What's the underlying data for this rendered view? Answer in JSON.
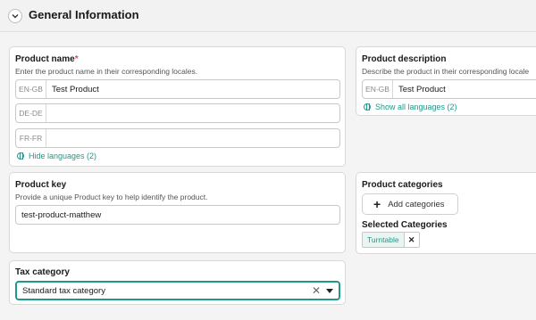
{
  "section": {
    "title": "General Information"
  },
  "product_name": {
    "label": "Product name",
    "required_mark": "*",
    "hint": "Enter the product name in their corresponding locales.",
    "locales": [
      {
        "code": "EN-GB",
        "value": "Test Product"
      },
      {
        "code": "DE-DE",
        "value": ""
      },
      {
        "code": "FR-FR",
        "value": ""
      }
    ],
    "toggle_label": "Hide languages (2)"
  },
  "product_description": {
    "label": "Product description",
    "hint": "Describe the product in their corresponding locale",
    "locales": [
      {
        "code": "EN-GB",
        "value": "Test Product"
      }
    ],
    "toggle_label": "Show all languages (2)"
  },
  "product_key": {
    "label": "Product key",
    "hint": "Provide a unique Product key to help identify the product.",
    "value": "test-product-matthew"
  },
  "product_categories": {
    "label": "Product categories",
    "add_button_label": "Add categories",
    "selected_label": "Selected Categories",
    "selected": [
      {
        "label": "Turntable",
        "remove_glyph": "✕"
      }
    ]
  },
  "tax_category": {
    "label": "Tax category",
    "value": "Standard tax category",
    "clear_glyph": "✕"
  },
  "icons": {
    "header": "chevron-down-icon",
    "languages": "globe-icon",
    "add": "plus-icon",
    "remove": "close-icon",
    "dropdown": "caret-down-icon"
  },
  "colors": {
    "accent": "#1d9a8a",
    "required": "#e84a4a",
    "background": "#f4f4f4"
  }
}
